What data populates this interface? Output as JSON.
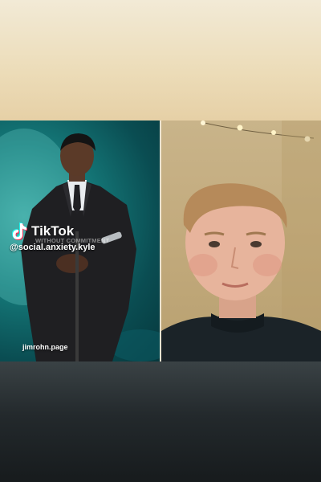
{
  "left_video": {
    "faint_caption": "WITHOUT COMMITMENT",
    "tiktok_label": "TikTok",
    "tiktok_handle": "@social.anxiety.kyle",
    "watermark": "jimrohn.page"
  },
  "colors": {
    "top_band": "#ecdcb8",
    "bottom_band": "#23292c",
    "left_bg": "#0a4d52",
    "right_bg": "#c2aa7c"
  },
  "icons": [
    "tiktok-icon"
  ]
}
